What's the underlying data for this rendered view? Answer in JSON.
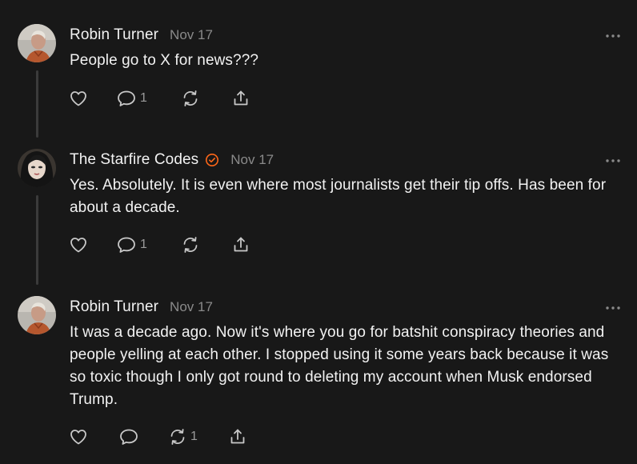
{
  "posts": [
    {
      "author": "Robin Turner",
      "date": "Nov 17",
      "text": "People go to X for news???",
      "actions": {
        "like_count": "",
        "reply_count": "1",
        "restack_count": ""
      },
      "verified": false
    },
    {
      "author": "The Starfire Codes",
      "date": "Nov 17",
      "text": "Yes. Absolutely. It is even where most journalists get their tip offs. Has been for about a decade.",
      "actions": {
        "like_count": "",
        "reply_count": "1",
        "restack_count": ""
      },
      "verified": true
    },
    {
      "author": "Robin Turner",
      "date": "Nov 17",
      "text": "It was a decade ago. Now it's where you go for batshit conspiracy theories and people yelling at each other. I stopped using it some years back because it was so toxic though I only got round to deleting my account when Musk endorsed Trump.",
      "actions": {
        "like_count": "",
        "reply_count": "",
        "restack_count": "1"
      },
      "verified": false
    }
  ],
  "icons": {
    "like": "heart-icon",
    "reply": "comment-bubble-icon",
    "restack": "restack-arrows-icon",
    "share": "share-upload-icon",
    "more": "ellipsis-icon",
    "verified": "verified-badge-icon"
  },
  "colors": {
    "background": "#181818",
    "text": "#f2f2f2",
    "muted": "#8a8a8a",
    "icon": "#c8c8c8",
    "verified": "#ff6719",
    "thread_line": "#3b3b3b"
  }
}
